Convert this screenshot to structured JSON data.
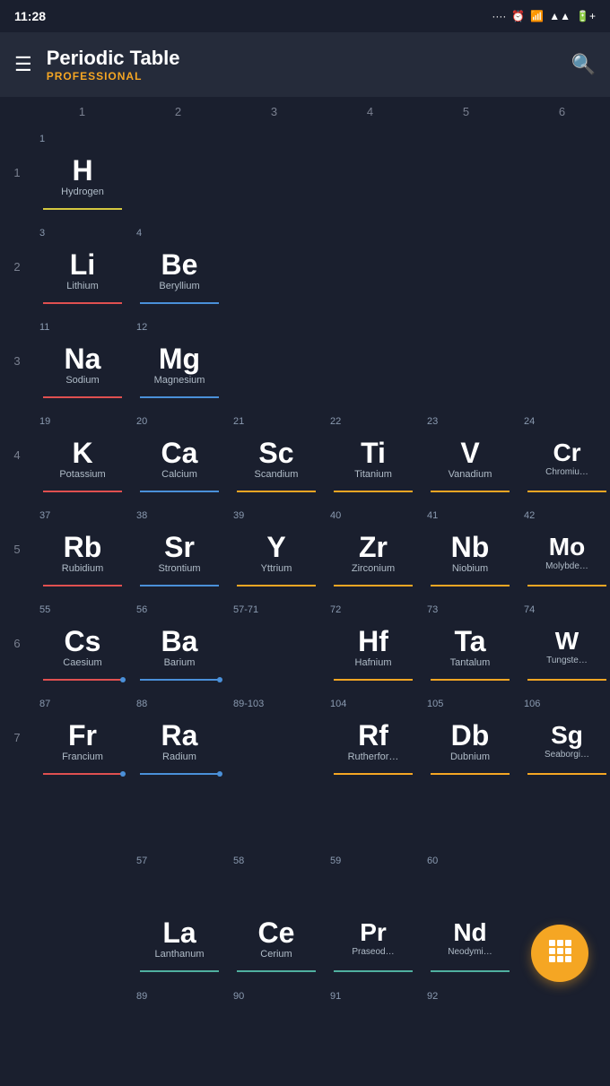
{
  "statusBar": {
    "time": "11:28",
    "icons": ".... ⏰ 📶 📶 ▲ 🔋"
  },
  "appBar": {
    "title": "Periodic Table",
    "subtitle": "PROFESSIONAL",
    "hamburgerLabel": "☰",
    "searchLabel": "🔍"
  },
  "colHeaders": [
    "1",
    "2",
    "3",
    "4",
    "5",
    "6"
  ],
  "periodLabels": [
    "1",
    "2",
    "3",
    "4",
    "5",
    "6",
    "7"
  ],
  "elements": {
    "H": {
      "number": "1",
      "symbol": "H",
      "name": "Hydrogen",
      "underline": "yellow",
      "period": 1,
      "group": 1
    },
    "Li": {
      "number": "3",
      "symbol": "Li",
      "name": "Lithium",
      "underline": "red",
      "period": 2,
      "group": 1
    },
    "Be": {
      "number": "4",
      "symbol": "Be",
      "name": "Beryllium",
      "underline": "blue",
      "period": 2,
      "group": 2
    },
    "Na": {
      "number": "11",
      "symbol": "Na",
      "name": "Sodium",
      "underline": "red",
      "period": 3,
      "group": 1
    },
    "Mg": {
      "number": "12",
      "symbol": "Mg",
      "name": "Magnesium",
      "underline": "blue",
      "period": 3,
      "group": 2
    },
    "K": {
      "number": "19",
      "symbol": "K",
      "name": "Potassium",
      "underline": "red",
      "period": 4,
      "group": 1
    },
    "Ca": {
      "number": "20",
      "symbol": "Ca",
      "name": "Calcium",
      "underline": "blue",
      "period": 4,
      "group": 2
    },
    "Sc": {
      "number": "21",
      "symbol": "Sc",
      "name": "Scandium",
      "underline": "orange",
      "period": 4,
      "group": 3
    },
    "Ti": {
      "number": "22",
      "symbol": "Ti",
      "name": "Titanium",
      "underline": "orange",
      "period": 4,
      "group": 4
    },
    "V": {
      "number": "23",
      "symbol": "V",
      "name": "Vanadium",
      "underline": "orange",
      "period": 4,
      "group": 5
    },
    "Cr": {
      "number": "24",
      "symbol": "Cr",
      "name": "Chromiu…",
      "underline": "orange",
      "period": 4,
      "group": 6
    },
    "Rb": {
      "number": "37",
      "symbol": "Rb",
      "name": "Rubidium",
      "underline": "red",
      "period": 5,
      "group": 1
    },
    "Sr": {
      "number": "38",
      "symbol": "Sr",
      "name": "Strontium",
      "underline": "blue",
      "period": 5,
      "group": 2
    },
    "Y": {
      "number": "39",
      "symbol": "Y",
      "name": "Yttrium",
      "underline": "orange",
      "period": 5,
      "group": 3
    },
    "Zr": {
      "number": "40",
      "symbol": "Zr",
      "name": "Zirconium",
      "underline": "orange",
      "period": 5,
      "group": 4
    },
    "Nb": {
      "number": "41",
      "symbol": "Nb",
      "name": "Niobium",
      "underline": "orange",
      "period": 5,
      "group": 5
    },
    "Mo": {
      "number": "42",
      "symbol": "Mo",
      "name": "Molybde…",
      "underline": "orange",
      "period": 5,
      "group": 6
    },
    "Cs": {
      "number": "55",
      "symbol": "Cs",
      "name": "Caesium",
      "underline": "red",
      "period": 6,
      "group": 1
    },
    "Ba": {
      "number": "56",
      "symbol": "Ba",
      "name": "Barium",
      "underline": "blue",
      "period": 6,
      "group": 2
    },
    "Hf": {
      "number": "72",
      "symbol": "Hf",
      "name": "Hafnium",
      "underline": "orange",
      "period": 6,
      "group": 4
    },
    "Ta": {
      "number": "73",
      "symbol": "Ta",
      "name": "Tantalum",
      "underline": "orange",
      "period": 6,
      "group": 5
    },
    "W": {
      "number": "74",
      "symbol": "W",
      "name": "Tungste…",
      "underline": "orange",
      "period": 6,
      "group": 6
    },
    "Fr": {
      "number": "87",
      "symbol": "Fr",
      "name": "Francium",
      "underline": "red",
      "period": 7,
      "group": 1
    },
    "Ra": {
      "number": "88",
      "symbol": "Ra",
      "name": "Radium",
      "underline": "blue",
      "period": 7,
      "group": 2
    },
    "Rf": {
      "number": "104",
      "symbol": "Rf",
      "name": "Rutherfor…",
      "underline": "orange",
      "period": 7,
      "group": 4
    },
    "Db": {
      "number": "105",
      "symbol": "Db",
      "name": "Dubnium",
      "underline": "orange",
      "period": 7,
      "group": 5
    },
    "Sg": {
      "number": "106",
      "symbol": "Sg",
      "name": "Seaborgi…",
      "underline": "orange",
      "period": 7,
      "group": 6
    },
    "La": {
      "number": "57",
      "symbol": "La",
      "name": "Lanthanum",
      "underline": "teal",
      "period": "lan",
      "group": 1
    },
    "Ce": {
      "number": "58",
      "symbol": "Ce",
      "name": "Cerium",
      "underline": "teal",
      "period": "lan",
      "group": 2
    },
    "Pr": {
      "number": "59",
      "symbol": "Pr",
      "name": "Praseod…",
      "underline": "teal",
      "period": "lan",
      "group": 3
    },
    "Nd": {
      "number": "60",
      "symbol": "Nd",
      "name": "Neodymi…",
      "underline": "teal",
      "period": "lan",
      "group": 4
    }
  },
  "rangeLabels": {
    "period6": "57-71",
    "period7": "89-103"
  },
  "fab": {
    "icon": "⊞",
    "label": "grid-view"
  }
}
